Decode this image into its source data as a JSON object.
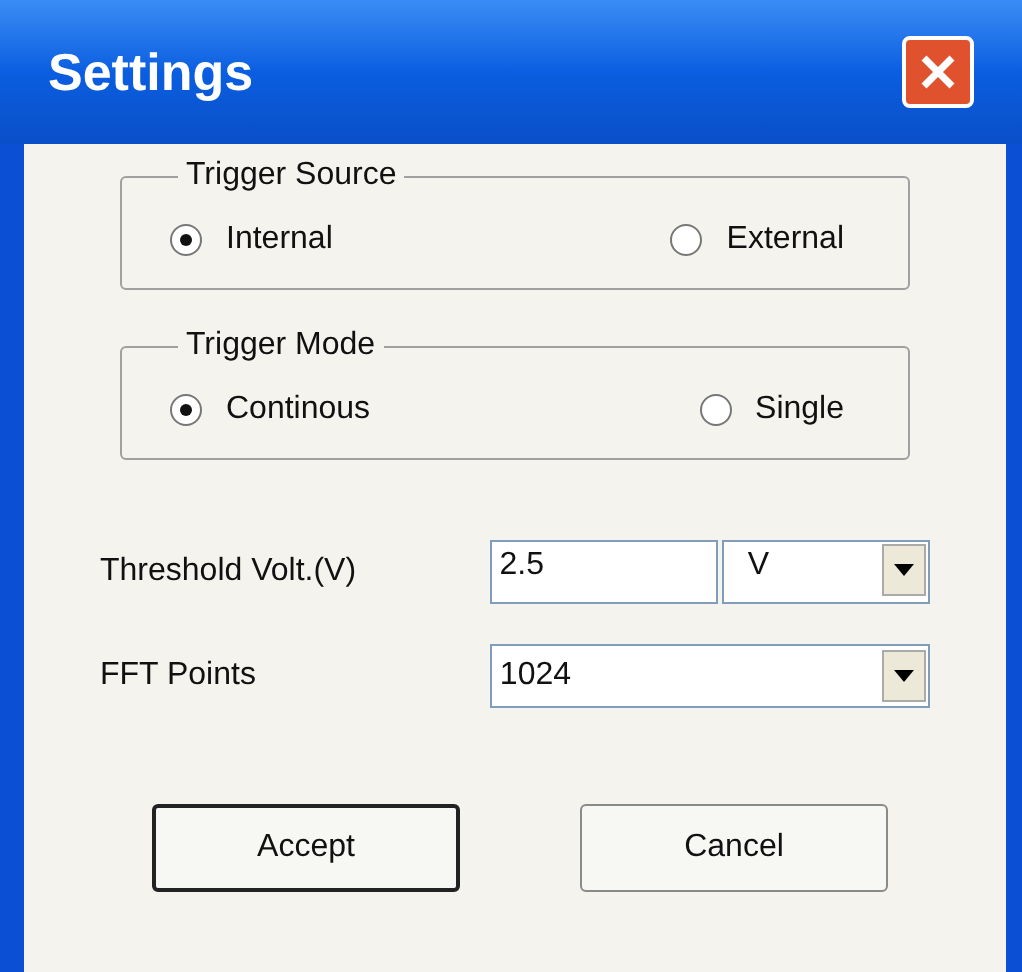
{
  "window": {
    "title": "Settings"
  },
  "groups": [
    {
      "title": "Trigger Source",
      "options": [
        {
          "label": "Internal",
          "selected": true
        },
        {
          "label": "External",
          "selected": false
        }
      ]
    },
    {
      "title": "Trigger Mode",
      "options": [
        {
          "label": "Continous",
          "selected": true
        },
        {
          "label": "Single",
          "selected": false
        }
      ]
    }
  ],
  "threshold": {
    "label": "Threshold Volt.(V)",
    "value": "2.5",
    "unit": "V"
  },
  "fft": {
    "label": "FFT Points",
    "value": "1024"
  },
  "buttons": [
    {
      "label": "Accept",
      "default": true
    },
    {
      "label": "Cancel",
      "default": false
    }
  ]
}
